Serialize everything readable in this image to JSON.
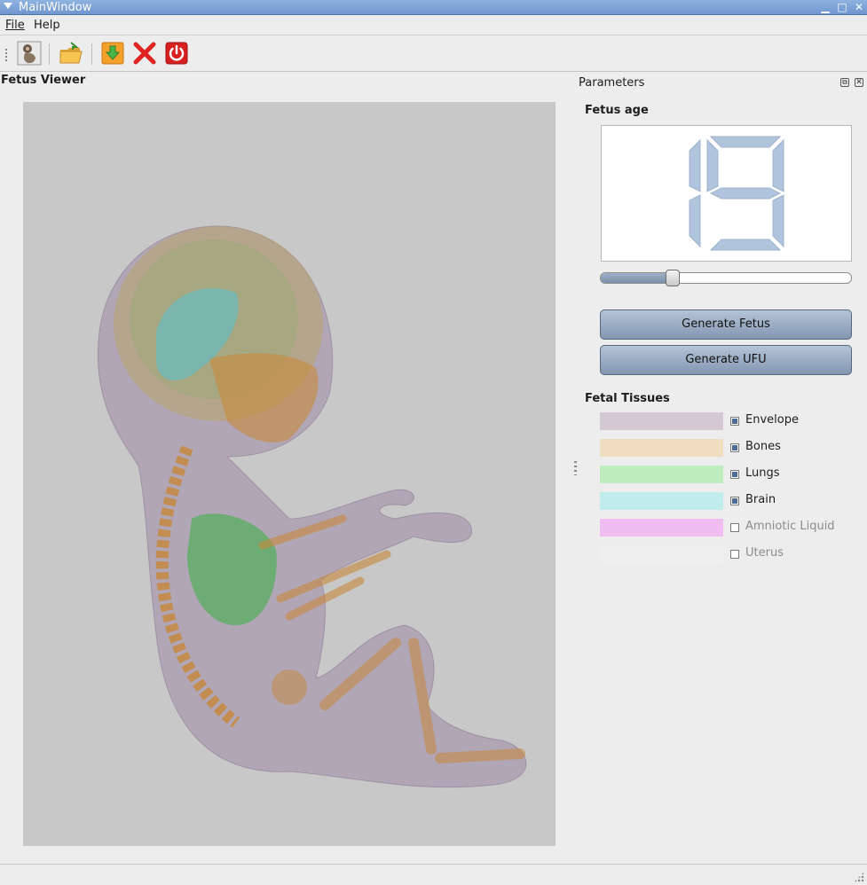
{
  "window": {
    "title": "MainWindow"
  },
  "menubar": {
    "items": [
      {
        "label": "File"
      },
      {
        "label": "Help"
      }
    ]
  },
  "toolbar": {
    "icons": [
      "fetus-icon",
      "open-folder-icon",
      "download-icon",
      "close-icon",
      "power-icon"
    ]
  },
  "viewer": {
    "title": "Fetus Viewer"
  },
  "parameters": {
    "title": "Parameters",
    "fetus_age": {
      "label": "Fetus age",
      "value": "19",
      "slider_fraction": 0.29
    },
    "buttons": {
      "generate_fetus": "Generate Fetus",
      "generate_ufu": "Generate UFU"
    },
    "tissues_label": "Fetal Tissues",
    "tissues": [
      {
        "name": "Envelope",
        "color": "#d3c8d3",
        "checked": true
      },
      {
        "name": "Bones",
        "color": "#f0dcc0",
        "checked": true
      },
      {
        "name": "Lungs",
        "color": "#bfedbf",
        "checked": true
      },
      {
        "name": "Brain",
        "color": "#c0ecec",
        "checked": true
      },
      {
        "name": "Amniotic Liquid",
        "color": "#efbdef",
        "checked": false
      },
      {
        "name": "Uterus",
        "color": "#efefef",
        "checked": false
      }
    ]
  },
  "colors": {
    "titlebar": "#7ea4d9",
    "button": "#94a8c2",
    "viewport_bg": "#c8c8c8",
    "lcd_digit": "#b0c4de"
  }
}
